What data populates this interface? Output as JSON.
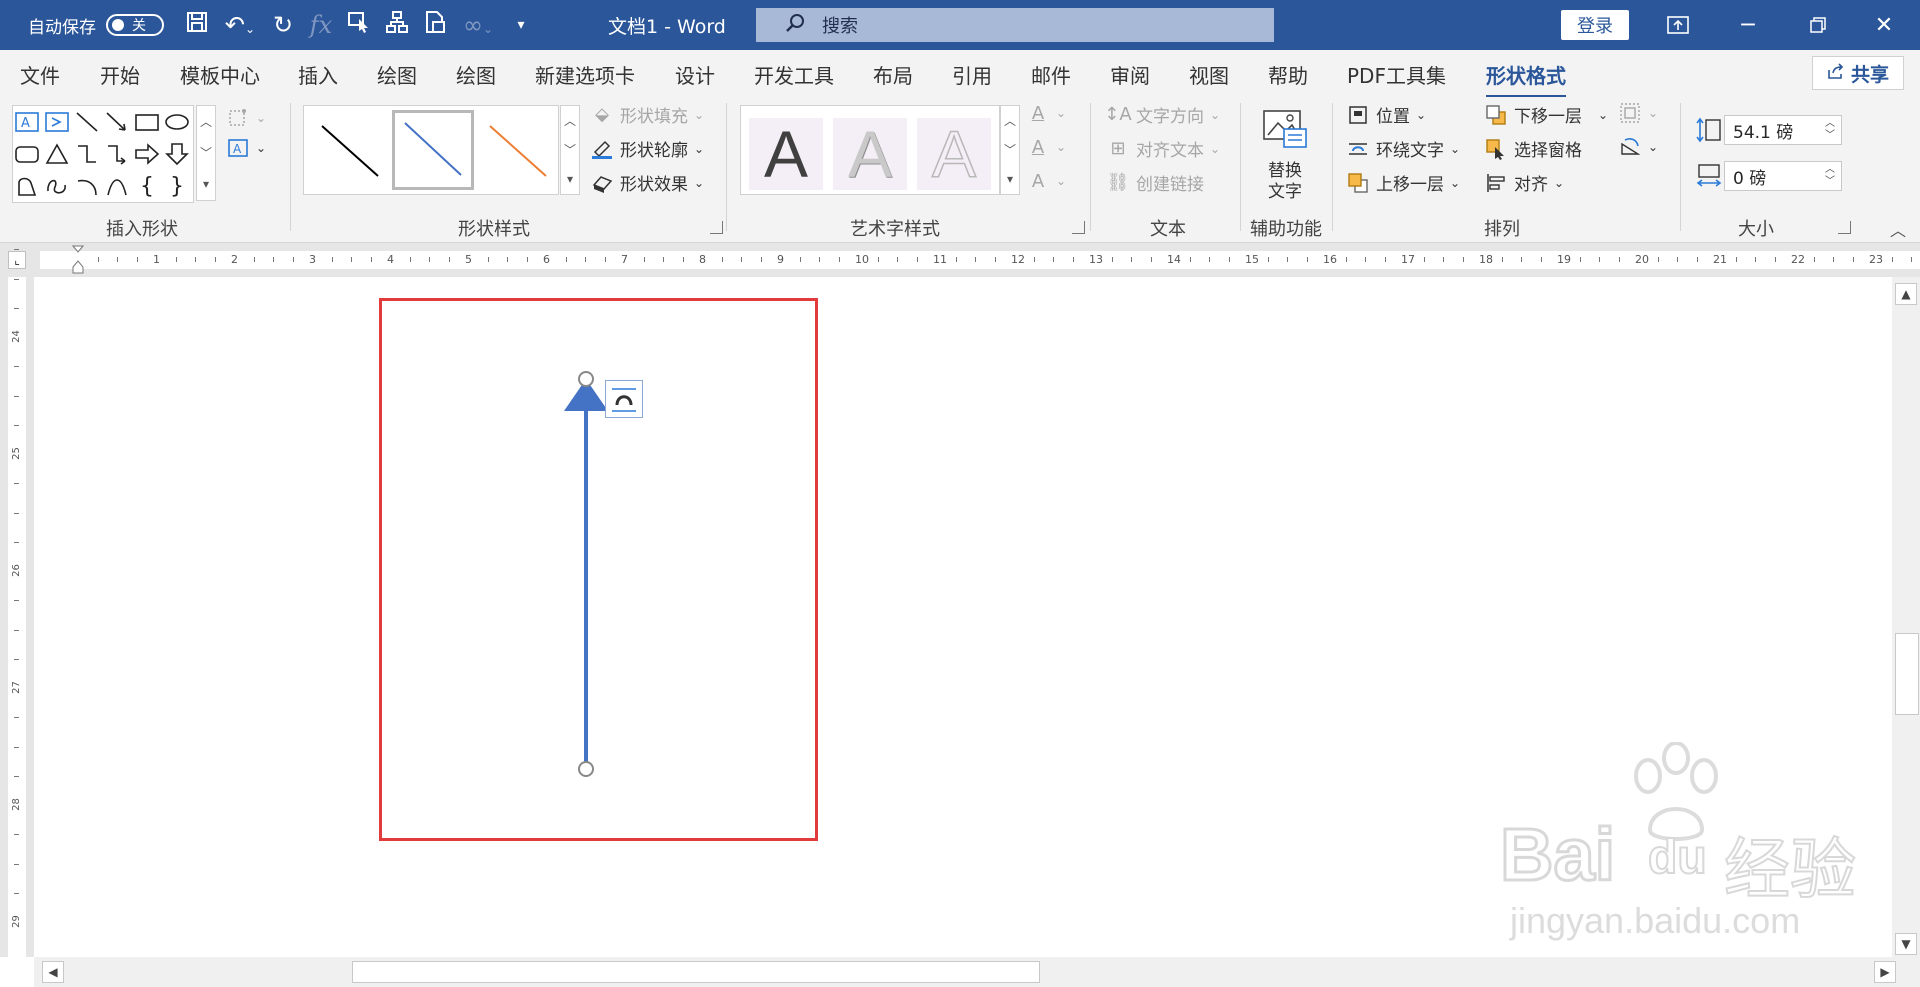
{
  "titlebar": {
    "autosave_label": "自动保存",
    "autosave_state": "关",
    "doc_title": "文档1 - Word",
    "search_placeholder": "搜索",
    "login_label": "登录"
  },
  "tabs": [
    "文件",
    "开始",
    "模板中心",
    "插入",
    "绘图",
    "绘图",
    "新建选项卡",
    "设计",
    "开发工具",
    "布局",
    "引用",
    "邮件",
    "审阅",
    "视图",
    "帮助",
    "PDF工具集",
    "形状格式"
  ],
  "active_tab": "形状格式",
  "share_label": "共享",
  "ribbon": {
    "insert_shapes": {
      "label": "插入形状"
    },
    "shape_styles": {
      "label": "形状样式",
      "fill": "形状填充",
      "outline": "形状轮廓",
      "effects": "形状效果"
    },
    "wordart": {
      "label": "艺术字样式",
      "letter": "A"
    },
    "text": {
      "label": "文本",
      "direction": "文字方向",
      "align": "对齐文本",
      "link": "创建链接"
    },
    "accessibility": {
      "label": "辅助功能",
      "alt_text_line1": "替换",
      "alt_text_line2": "文字"
    },
    "arrange": {
      "label": "排列",
      "position": "位置",
      "wrap": "环绕文字",
      "bring_forward": "上移一层",
      "send_backward": "下移一层",
      "selection_pane": "选择窗格",
      "align": "对齐"
    },
    "size": {
      "label": "大小",
      "height": "54.1 磅",
      "width": "0 磅"
    }
  },
  "ruler": {
    "h_numbers": [
      "1",
      "2",
      "3",
      "4",
      "5",
      "6",
      "7",
      "8",
      "9",
      "10",
      "11",
      "12",
      "13",
      "14",
      "15",
      "16",
      "17",
      "18",
      "19",
      "20",
      "21",
      "22",
      "23"
    ],
    "v_numbers": [
      "24",
      "25",
      "26",
      "27",
      "28",
      "29"
    ]
  },
  "watermark": {
    "brand": "Bai",
    "brand2": "du",
    "cn": "经验",
    "url": "jingyan.baidu.com"
  },
  "colors": {
    "accent": "#2b579a",
    "arrow": "#4472c4",
    "highlight": "#e23b3b"
  }
}
